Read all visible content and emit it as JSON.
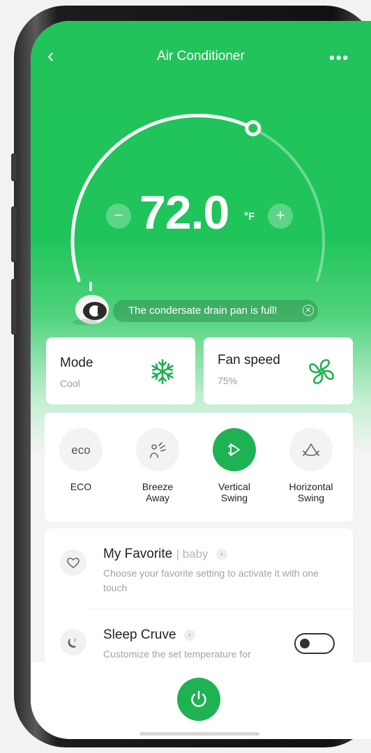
{
  "header": {
    "back_glyph": "‹",
    "title": "Air Conditioner",
    "more_glyph": "•••"
  },
  "thermostat": {
    "minus_glyph": "−",
    "plus_glyph": "+",
    "value": "72.0",
    "unit": "°F",
    "dial_fill_percent": 62
  },
  "alert": {
    "message": "The condersate drain pan is full!",
    "close_glyph": "✕"
  },
  "mode": {
    "label": "Mode",
    "value": "Cool",
    "icon": "snowflake-icon"
  },
  "fan": {
    "label": "Fan speed",
    "value": "75%",
    "icon": "fan-icon"
  },
  "functions": [
    {
      "label": "ECO",
      "icon": "eco-icon",
      "active": false
    },
    {
      "label": "Breeze\nAway",
      "icon": "breeze-away-icon",
      "active": false
    },
    {
      "label": "Vertical\nSwing",
      "icon": "vertical-swing-icon",
      "active": true
    },
    {
      "label": "Horizontal\nSwing",
      "icon": "horizontal-swing-icon",
      "active": false
    }
  ],
  "favorite": {
    "title": "My Favorite",
    "tag": "baby",
    "description": "Choose your favorite setting to activate it with one touch",
    "icon": "heart-icon"
  },
  "sleep": {
    "title": "Sleep Cruve",
    "description": "Customize the set temperature for",
    "icon": "sleep-moon-icon",
    "toggle_on": false
  },
  "colors": {
    "brand": "#1fb252",
    "hero": "#22c35a",
    "text": "#222222",
    "muted": "#9a9a9a"
  }
}
